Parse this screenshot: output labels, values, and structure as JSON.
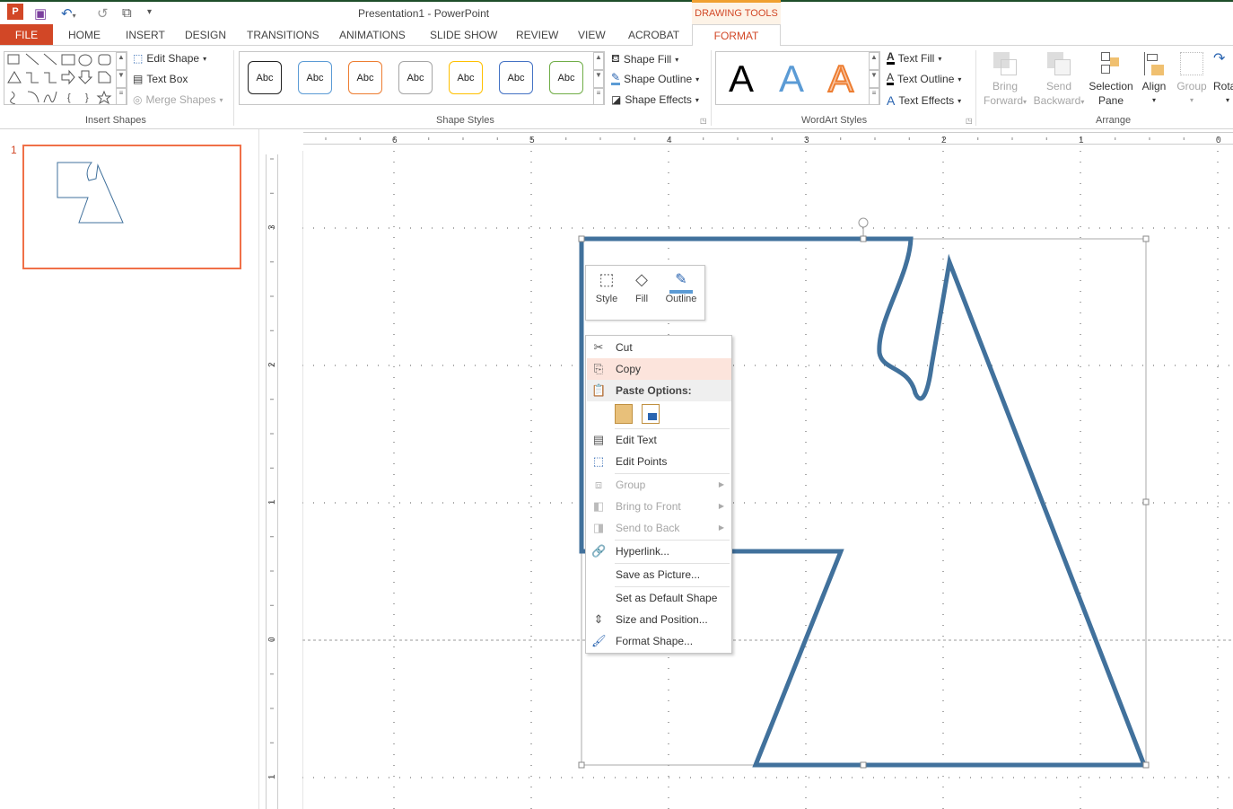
{
  "window": {
    "title": "Presentation1 - PowerPoint",
    "context_tab_group": "DRAWING TOOLS"
  },
  "qat": {
    "app_icon": "powerpoint-icon",
    "save_icon": "save-icon",
    "undo_icon": "undo-icon",
    "redo_icon": "redo-icon",
    "present_icon": "start-from-beginning-icon",
    "customize_icon": "customize-qat-icon"
  },
  "tabs": [
    {
      "label": "FILE"
    },
    {
      "label": "HOME"
    },
    {
      "label": "INSERT"
    },
    {
      "label": "DESIGN"
    },
    {
      "label": "TRANSITIONS"
    },
    {
      "label": "ANIMATIONS"
    },
    {
      "label": "SLIDE SHOW"
    },
    {
      "label": "REVIEW"
    },
    {
      "label": "VIEW"
    },
    {
      "label": "ACROBAT"
    },
    {
      "label": "FORMAT",
      "active": true
    }
  ],
  "ribbon": {
    "insert_shapes": {
      "label": "Insert Shapes",
      "edit_shape": "Edit Shape",
      "text_box": "Text Box",
      "merge_shapes": "Merge Shapes"
    },
    "shape_styles": {
      "label": "Shape Styles",
      "swatch_text": "Abc",
      "swatches": [
        "#222222",
        "#5b9bd5",
        "#ed7d31",
        "#a5a5a5",
        "#ffc000",
        "#4472c4",
        "#70ad47"
      ],
      "shape_fill": "Shape Fill",
      "shape_outline": "Shape Outline",
      "shape_effects": "Shape Effects"
    },
    "wordart_styles": {
      "label": "WordArt Styles",
      "letter": "A",
      "text_fill": "Text Fill",
      "text_outline": "Text Outline",
      "text_effects": "Text Effects"
    },
    "arrange": {
      "label": "Arrange",
      "bring_forward": [
        "Bring",
        "Forward"
      ],
      "send_backward": [
        "Send",
        "Backward"
      ],
      "selection_pane": [
        "Selection",
        "Pane"
      ],
      "align": "Align",
      "group": "Group",
      "rotate": "Rota"
    }
  },
  "slides": {
    "number": "1"
  },
  "rulers": {
    "horizontal": [
      "6",
      "5",
      "4",
      "3",
      "2",
      "1",
      "0"
    ],
    "vertical": [
      "3",
      "2",
      "1",
      "0",
      "1"
    ]
  },
  "mini_toolbar": {
    "style": "Style",
    "fill": "Fill",
    "outline": "Outline"
  },
  "context_menu": {
    "cut": "Cut",
    "copy": "Copy",
    "paste_options": "Paste Options:",
    "edit_text": "Edit Text",
    "edit_points": "Edit Points",
    "group": "Group",
    "bring_to_front": "Bring to Front",
    "send_to_back": "Send to Back",
    "hyperlink": "Hyperlink...",
    "save_as_picture": "Save as Picture...",
    "set_default": "Set as Default Shape",
    "size_position": "Size and Position...",
    "format_shape": "Format Shape..."
  },
  "colors": {
    "accent": "#d24726",
    "shape_stroke": "#41719c",
    "hover": "#fce4dc"
  }
}
